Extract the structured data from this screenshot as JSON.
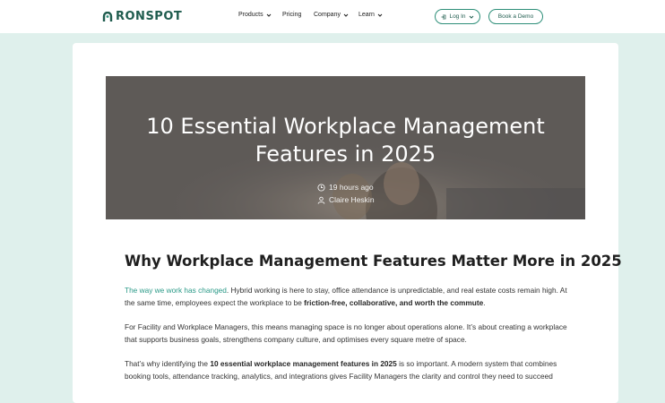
{
  "header": {
    "logo_text": "RONSPOT",
    "nav": {
      "products": "Products",
      "pricing": "Pricing",
      "company": "Company",
      "learn": "Learn"
    },
    "login_label": "Log In",
    "demo_label": "Book a Demo"
  },
  "colors": {
    "brand": "#1f5c4e",
    "accent": "#2e8f79",
    "link": "#2b9a88",
    "band": "#dff0ec"
  },
  "hero": {
    "title_line1": "10 Essential Workplace Management",
    "title_line2": "Features in 2025",
    "time": "19 hours ago",
    "author": "Claire Heskin"
  },
  "article": {
    "heading": "Why Workplace Management Features Matter More in 2025",
    "p1": {
      "link": "The way we work has changed",
      "text_a": ". Hybrid working is here to stay, office attendance is unpredictable, and real estate costs remain high. At the same time, employees expect the workplace to be ",
      "bold": "friction-free, collaborative, and worth the commute",
      "text_b": "."
    },
    "p2": "For Facility and Workplace Managers, this means managing space is no longer about operations alone. It’s about creating a workplace that supports business goals, strengthens company culture, and optimises every square metre of space.",
    "p3": {
      "text_a": "That’s why identifying the ",
      "bold": "10 essential workplace management features in 2025",
      "text_b": " is so important. A modern system that combines booking tools, attendance tracking, analytics, and integrations gives Facility Managers the clarity and control they need to succeed"
    }
  }
}
